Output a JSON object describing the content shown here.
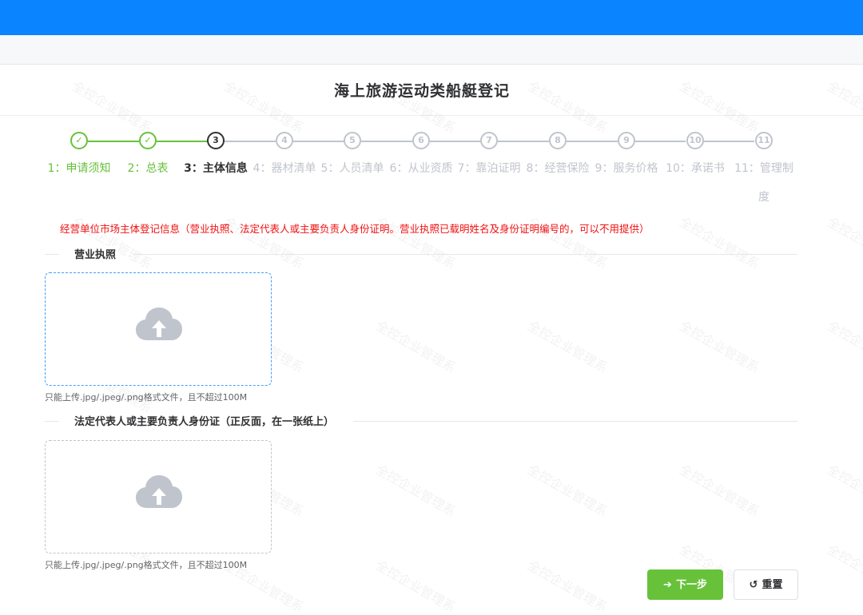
{
  "header": {
    "color": "#0a84ff"
  },
  "form": {
    "title": "海上旅游运动类船艇登记"
  },
  "steps": [
    {
      "index": "1",
      "label": "1：申请须知",
      "status": "done"
    },
    {
      "index": "2",
      "label": "2：总表",
      "status": "done"
    },
    {
      "index": "3",
      "label": "3：主体信息",
      "status": "active"
    },
    {
      "index": "4",
      "label": "4：器材清单",
      "status": "pending"
    },
    {
      "index": "5",
      "label": "5：人员清单",
      "status": "pending"
    },
    {
      "index": "6",
      "label": "6：从业资质",
      "status": "pending"
    },
    {
      "index": "7",
      "label": "7：靠泊证明",
      "status": "pending"
    },
    {
      "index": "8",
      "label": "8：经营保险",
      "status": "pending"
    },
    {
      "index": "9",
      "label": "9：服务价格",
      "status": "pending"
    },
    {
      "index": "10",
      "label": "10：承诺书",
      "status": "pending"
    },
    {
      "index": "11",
      "label": "11：管理制度",
      "status": "pending"
    }
  ],
  "notice": "经营单位市场主体登记信息（营业执照、法定代表人或主要负责人身份证明。营业执照已载明姓名及身份证明编号的，可以不用提供）",
  "sections": [
    {
      "title": "营业执照",
      "upload_icon": "cloud-upload-icon",
      "hint": "只能上传.jpg/.jpeg/.png格式文件，且不超过100M"
    },
    {
      "title": "法定代表人或主要负责人身份证（正反面，在一张纸上）",
      "upload_icon": "cloud-upload-icon",
      "hint": "只能上传.jpg/.jpeg/.png格式文件，且不超过100M"
    }
  ],
  "actions": {
    "next_label": "下一步",
    "next_icon": "arrow-right-icon",
    "reset_label": "重置",
    "reset_icon": "refresh-icon"
  },
  "watermark": "全控企业管理系",
  "colors": {
    "done": "#67c23a",
    "pending": "#c0c4cc",
    "notice": "#f01010",
    "active_border": "#409eff"
  }
}
